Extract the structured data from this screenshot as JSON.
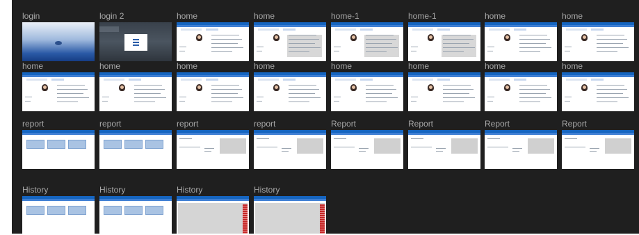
{
  "frames": [
    {
      "name": "login",
      "kind": "login"
    },
    {
      "name": "login 2",
      "kind": "login2"
    },
    {
      "name": "home",
      "kind": "home"
    },
    {
      "name": "home",
      "kind": "home-gray"
    },
    {
      "name": "home-1",
      "kind": "home-gray"
    },
    {
      "name": "home-1",
      "kind": "home-gray"
    },
    {
      "name": "home",
      "kind": "home"
    },
    {
      "name": "home",
      "kind": "home"
    },
    {
      "name": "home",
      "kind": "home"
    },
    {
      "name": "home",
      "kind": "home"
    },
    {
      "name": "home",
      "kind": "home"
    },
    {
      "name": "home",
      "kind": "home"
    },
    {
      "name": "home",
      "kind": "home"
    },
    {
      "name": "home",
      "kind": "home"
    },
    {
      "name": "home",
      "kind": "home"
    },
    {
      "name": "home",
      "kind": "home"
    },
    {
      "name": "report",
      "kind": "report-cards"
    },
    {
      "name": "report",
      "kind": "report-cards"
    },
    {
      "name": "report",
      "kind": "report-panel"
    },
    {
      "name": "report",
      "kind": "report-panel"
    },
    {
      "name": "Report",
      "kind": "report-panel"
    },
    {
      "name": "Report",
      "kind": "report-panel"
    },
    {
      "name": "Report",
      "kind": "report-panel"
    },
    {
      "name": "Report",
      "kind": "report-panel"
    },
    {
      "name": "History",
      "kind": "report-cards"
    },
    {
      "name": "History",
      "kind": "report-cards"
    },
    {
      "name": "History",
      "kind": "history-table"
    },
    {
      "name": "History",
      "kind": "history-table"
    }
  ],
  "colors": {
    "canvas": "#1f1f1f",
    "frame_label": "#a8a8a8",
    "app_bar": "#1565c0"
  }
}
